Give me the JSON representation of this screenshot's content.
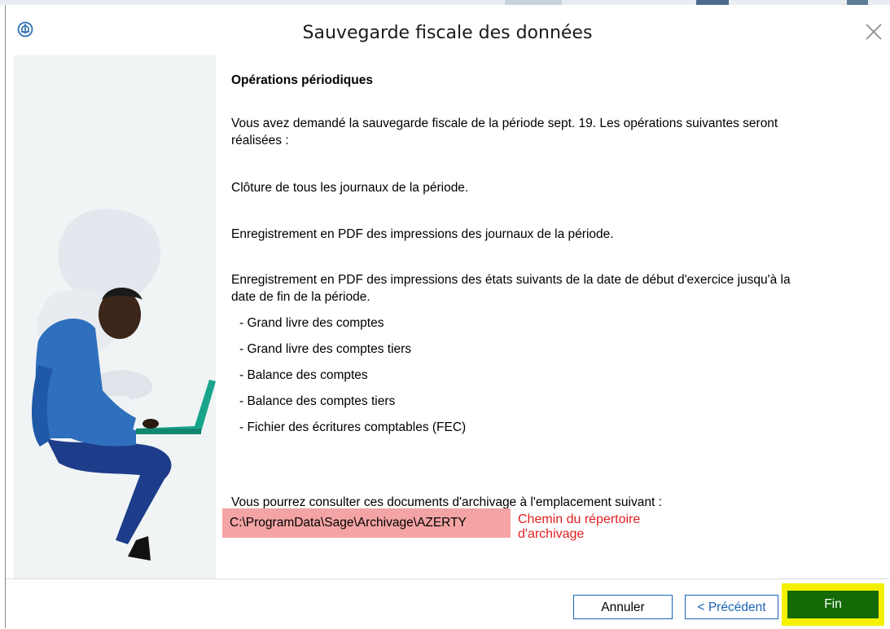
{
  "window": {
    "title": "Sauvegarde fiscale des données",
    "app_icon": "sage-logo-icon",
    "close_icon": "close-icon"
  },
  "content": {
    "heading": "Opérations périodiques",
    "intro_line1": "Vous avez demandé la sauvegarde fiscale de la période sept. 19. Les opérations suivantes seront",
    "intro_line2": "réalisées :",
    "op1": "Clôture de tous les journaux de la période.",
    "op2": "Enregistrement en PDF des impressions des journaux de la période.",
    "op3_line1": "Enregistrement en PDF des impressions des états suivants de la date de début d'exercice jusqu'à la",
    "op3_line2": "date de fin de la période.",
    "reports": [
      "- Grand livre des comptes",
      "- Grand livre des comptes tiers",
      "- Balance des comptes",
      "- Balance des comptes tiers",
      "- Fichier des écritures comptables (FEC)"
    ],
    "location_label": "Vous pourrez consulter ces documents d'archivage à l'emplacement suivant :",
    "archive_path": "C:\\ProgramData\\Sage\\Archivage\\AZERTY",
    "annotation_line1": "Chemin du répertoire",
    "annotation_line2": "d'archivage"
  },
  "buttons": {
    "cancel": "Annuler",
    "previous": "< Précédent",
    "finish": "Fin"
  },
  "colors": {
    "path_highlight": "#f4a4a4",
    "annotation_text": "#e02020",
    "finish_highlight": "#f5f000",
    "finish_button": "#146a06",
    "accent_border": "#1b64b7"
  }
}
